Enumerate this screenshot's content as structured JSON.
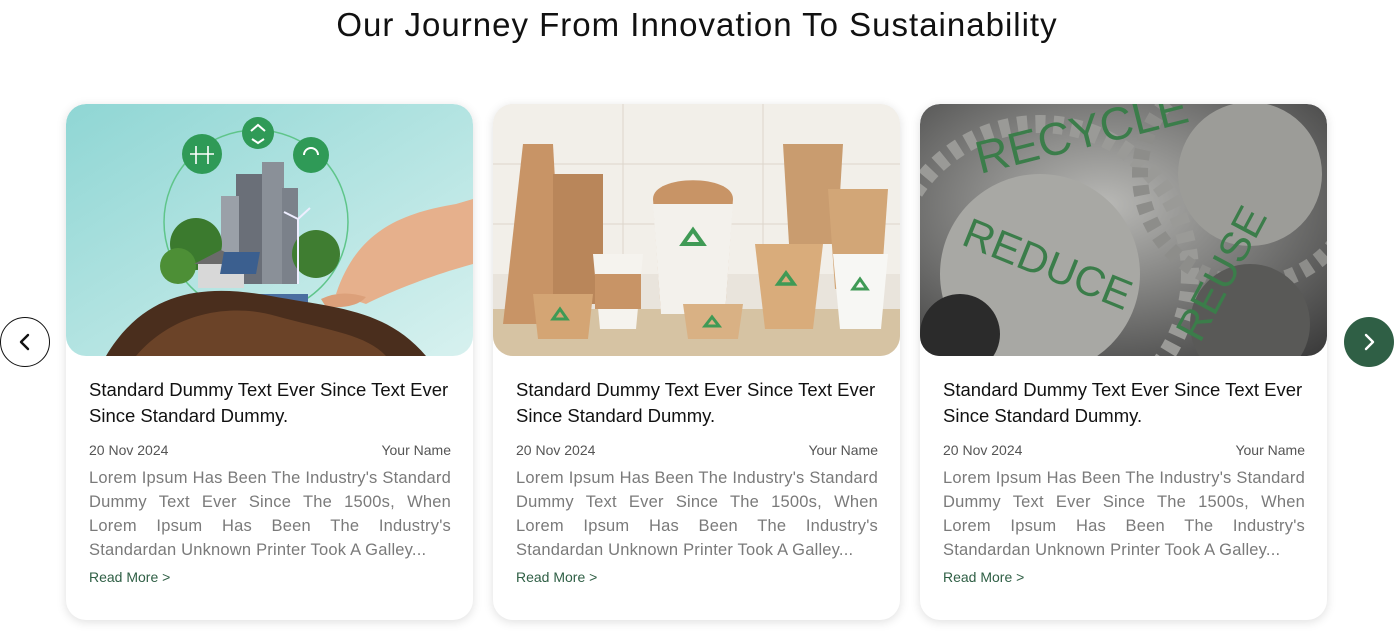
{
  "section": {
    "title": "Our Journey From Innovation To Sustainability"
  },
  "nav": {
    "prev_icon": "chevron-left-icon",
    "next_icon": "chevron-right-icon",
    "next_color": "#2f5f45"
  },
  "cards": [
    {
      "image": "eco-city-hand-image",
      "title": "Standard Dummy Text Ever Since Text Ever Since Standard Dummy.",
      "date": "20 Nov 2024",
      "author": "Your Name",
      "excerpt": "Lorem Ipsum Has Been The Industry's Standard Dummy Text Ever Since The 1500s, When Lorem Ipsum Has Been The Industry's Standardan Unknown Printer Took A Galley...",
      "link": "Read More >"
    },
    {
      "image": "recyclable-packaging-image",
      "title": "Standard Dummy Text Ever Since Text Ever Since Standard Dummy.",
      "date": "20 Nov 2024",
      "author": "Your Name",
      "excerpt": "Lorem Ipsum Has Been The Industry's Standard Dummy Text Ever Since The 1500s, When Lorem Ipsum Has Been The Industry's Standardan Unknown Printer Took A Galley...",
      "link": "Read More >"
    },
    {
      "image": "recycle-reduce-reuse-gears-image",
      "title": "Standard Dummy Text Ever Since Text Ever Since Standard Dummy.",
      "date": "20 Nov 2024",
      "author": "Your Name",
      "excerpt": "Lorem Ipsum Has Been The Industry's Standard Dummy Text Ever Since The 1500s, When Lorem Ipsum Has Been The Industry's Standardan Unknown Printer Took A Galley...",
      "link": "Read More >",
      "image_words": [
        "RECYCLE",
        "REDUCE",
        "REUSE"
      ]
    }
  ]
}
